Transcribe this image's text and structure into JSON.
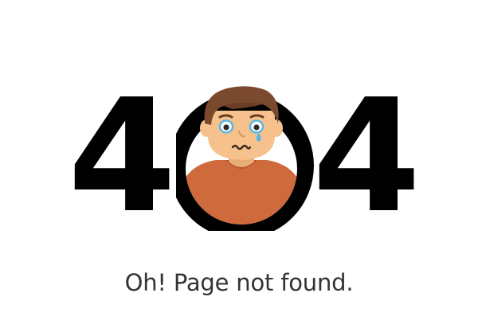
{
  "error": {
    "code_first_digit": "4",
    "code_last_digit": "4",
    "message": "Oh! Page not found."
  },
  "illustration": {
    "icon": "crying-man-icon",
    "ring_color": "#000000",
    "skin_color": "#F6C18C",
    "hair_color": "#7B4A2E",
    "shirt_color": "#CF6A3C",
    "tear_color": "#5CB7E0"
  }
}
